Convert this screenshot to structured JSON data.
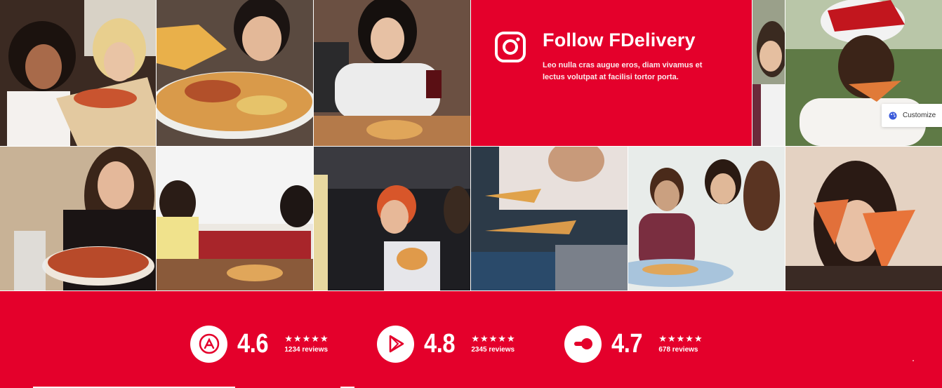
{
  "follow": {
    "title": "Follow FDelivery",
    "description": "Leo nulla cras augue eros, diam vivamus et lectus volutpat at facilisi tortor porta."
  },
  "customize": {
    "label": "Customize",
    "icon": "palette-icon"
  },
  "ratings": [
    {
      "store": "app-store",
      "icon": "app-store-icon",
      "score": "4.6",
      "stars": "★★★★★",
      "reviews": "1234 reviews"
    },
    {
      "store": "google-play",
      "icon": "play-store-icon",
      "score": "4.8",
      "stars": "★★★★★",
      "reviews": "2345 reviews"
    },
    {
      "store": "tripadvisor",
      "icon": "review-site-icon",
      "score": "4.7",
      "stars": "★★★★★",
      "reviews": "678 reviews"
    }
  ],
  "colors": {
    "brand_red": "#e4002b",
    "white": "#ffffff"
  }
}
